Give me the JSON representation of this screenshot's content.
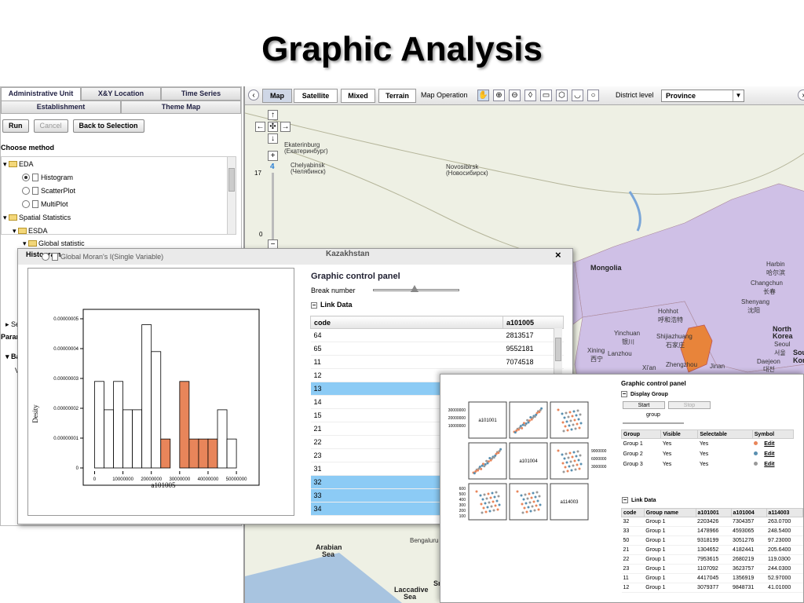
{
  "slide_title": "Graphic Analysis",
  "left_panel": {
    "tabs_row1": [
      "Administrative Unit",
      "X&Y Location",
      "Time Series"
    ],
    "tabs_row2": [
      "Establishment",
      "Theme Map"
    ],
    "buttons": {
      "run": "Run",
      "cancel": "Cancel",
      "back": "Back to Selection"
    },
    "choose_method": "Choose method",
    "tree": {
      "eda": "EDA",
      "histogram": "Histogram",
      "scatterplot": "ScatterPlot",
      "multiplot": "MultiPlot",
      "spatial": "Spatial Statistics",
      "esda": "ESDA",
      "global": "Global statistic",
      "moran": "Global Moran's I(Single Variable)"
    },
    "partial_labels": {
      "sel": "Sele",
      "param": "Param",
      "bas": "Bas",
      "var": "Va"
    }
  },
  "map": {
    "toolbar": {
      "map": "Map",
      "satellite": "Satellite",
      "mixed": "Mixed",
      "terrain": "Terrain",
      "map_operation": "Map Operation",
      "district_level": "District level",
      "district_value": "Province"
    },
    "zoom_level": "4",
    "scale_top": "17",
    "scale_bottom": "0",
    "labels": {
      "ekaterinburg": "Ekaterinburg",
      "ekaterinburg_ru": "(Екатеринбург)",
      "chelyabinsk": "Chelyabinsk",
      "chelyabinsk_ru": "(Челябинск)",
      "novosibirsk": "Novosibirsk",
      "novosibirsk_ru": "(Новосибирск)",
      "kazakhstan": "Kazakhstan",
      "mongolia": "Mongolia",
      "harbin": "Harbin",
      "harbin_cn": "哈尔滨",
      "changchun": "Changchun",
      "changchun_cn": "长春",
      "shenyang": "Shenyang",
      "shenyang_cn": "沈阳",
      "hohhot": "Hohhot",
      "hohhot_cn": "呼和浩特",
      "yinchuan": "Yinchuan",
      "yinchuan_cn": "银川",
      "shijiazhuang": "Shijiazhuang",
      "shijiazhuang_cn": "石家庄",
      "xining": "Xining",
      "xining_cn": "西宁",
      "lanzhou": "Lanzhou",
      "lanzhou_cn": "兰州",
      "xian": "Xi'an",
      "zhengzhou": "Zhengzhou",
      "jinan": "Jinan",
      "north_korea": "North",
      "north_korea2": "Korea",
      "seoul": "Seoul",
      "seoul_kr": "서울",
      "daejeon": "Daejeon",
      "daejeon_kr": "대전",
      "south_korea": "South",
      "south_korea2": "Korea",
      "arabian": "Arabian",
      "arabian2": "Sea",
      "bengaluru": "Bengaluru",
      "laccadive": "Laccadive",
      "laccadive2": "Sea",
      "sri": "Sri"
    }
  },
  "hist_window": {
    "title": "Histogram",
    "control_title": "Graphic control panel",
    "break_number": "Break number",
    "link_data": "Link Data",
    "table_headers": [
      "code",
      "a101005"
    ],
    "rows": [
      {
        "code": "64",
        "value": "2813517",
        "selected": false
      },
      {
        "code": "65",
        "value": "9552181",
        "selected": false
      },
      {
        "code": "11",
        "value": "7074518",
        "selected": false
      },
      {
        "code": "12",
        "value": "",
        "selected": false
      },
      {
        "code": "13",
        "value": "",
        "selected": true
      },
      {
        "code": "14",
        "value": "",
        "selected": false
      },
      {
        "code": "15",
        "value": "",
        "selected": false
      },
      {
        "code": "21",
        "value": "",
        "selected": false
      },
      {
        "code": "22",
        "value": "",
        "selected": false
      },
      {
        "code": "23",
        "value": "",
        "selected": false
      },
      {
        "code": "31",
        "value": "",
        "selected": false
      },
      {
        "code": "32",
        "value": "",
        "selected": true
      },
      {
        "code": "33",
        "value": "",
        "selected": true
      },
      {
        "code": "34",
        "value": "",
        "selected": true
      }
    ]
  },
  "chart_data": {
    "type": "bar",
    "xlabel": "a101005",
    "ylabel": "Desity",
    "x_ticks": [
      "0",
      "10000000",
      "20000000",
      "30000000",
      "40000000",
      "50000000"
    ],
    "y_ticks": [
      "0",
      "0.00000001",
      "0.00000002",
      "0.00000003",
      "0.00000004",
      "0.00000005"
    ],
    "xlim": [
      -4000000,
      58000000
    ],
    "ylim": [
      0,
      5e-08
    ],
    "bin_width": 3333333,
    "bins": [
      {
        "start": 0,
        "value": 2.9e-08,
        "highlight": false
      },
      {
        "start": 3333333,
        "value": 1.95e-08,
        "highlight": false
      },
      {
        "start": 6666667,
        "value": 2.9e-08,
        "highlight": false
      },
      {
        "start": 10000000,
        "value": 1.95e-08,
        "highlight": false
      },
      {
        "start": 13333333,
        "value": 1.95e-08,
        "highlight": false
      },
      {
        "start": 16666667,
        "value": 4.8e-08,
        "highlight": false
      },
      {
        "start": 20000000,
        "value": 3.9e-08,
        "highlight": false
      },
      {
        "start": 23333333,
        "value": 9.7e-09,
        "highlight": true
      },
      {
        "start": 30000000,
        "value": 2.9e-08,
        "highlight": true
      },
      {
        "start": 33333333,
        "value": 9.7e-09,
        "highlight": true
      },
      {
        "start": 36666667,
        "value": 9.7e-09,
        "highlight": true
      },
      {
        "start": 40000000,
        "value": 9.7e-09,
        "highlight": true
      },
      {
        "start": 43333333,
        "value": 1.95e-08,
        "highlight": false
      },
      {
        "start": 46666667,
        "value": 9.7e-09,
        "highlight": false
      }
    ],
    "colors": {
      "normal": "#ffffff",
      "highlight": "#e8855a"
    }
  },
  "scatter_window": {
    "diagonal_labels": [
      "a101001",
      "a101004",
      "a114003"
    ],
    "axis_ticks_left1": [
      "30000000",
      "20000000",
      "10000000"
    ],
    "axis_ticks_left3": [
      "600",
      "500",
      "400",
      "300",
      "200",
      "100"
    ],
    "axis_ticks_right2": [
      "9000000",
      "6000000",
      "3000000"
    ],
    "control_title": "Graphic control panel",
    "display_group": "Display Group",
    "start": "Start",
    "stop": "Stop",
    "group_label": "group",
    "group_headers": [
      "Group",
      "Visible",
      "Selectable",
      "Symbol"
    ],
    "groups": [
      {
        "name": "Group 1",
        "visible": "Yes",
        "selectable": "Yes",
        "edit": "Edit",
        "color": "#e8855a"
      },
      {
        "name": "Group 2",
        "visible": "Yes",
        "selectable": "Yes",
        "edit": "Edit",
        "color": "#5a8fb0"
      },
      {
        "name": "Group 3",
        "visible": "Yes",
        "selectable": "Yes",
        "edit": "Edit",
        "color": "#999999"
      }
    ],
    "link_data": "Link Data",
    "link_headers": [
      "code",
      "Group name",
      "a101001",
      "a101004",
      "a114003"
    ],
    "link_rows": [
      [
        "32",
        "Group 1",
        "2203426",
        "7304357",
        "263.0700"
      ],
      [
        "33",
        "Group 1",
        "1478966",
        "4593065",
        "248.5400"
      ],
      [
        "50",
        "Group 1",
        "9318199",
        "3051276",
        "97.23000"
      ],
      [
        "21",
        "Group 1",
        "1304652",
        "4182441",
        "205.6400"
      ],
      [
        "22",
        "Group 1",
        "7953615",
        "2680219",
        "119.0300"
      ],
      [
        "23",
        "Group 1",
        "1107092",
        "3623757",
        "244.0300"
      ],
      [
        "11",
        "Group 1",
        "4417045",
        "1356919",
        "52.97000"
      ],
      [
        "12",
        "Group 1",
        "3079377",
        "9848731",
        "41.01000"
      ]
    ]
  }
}
